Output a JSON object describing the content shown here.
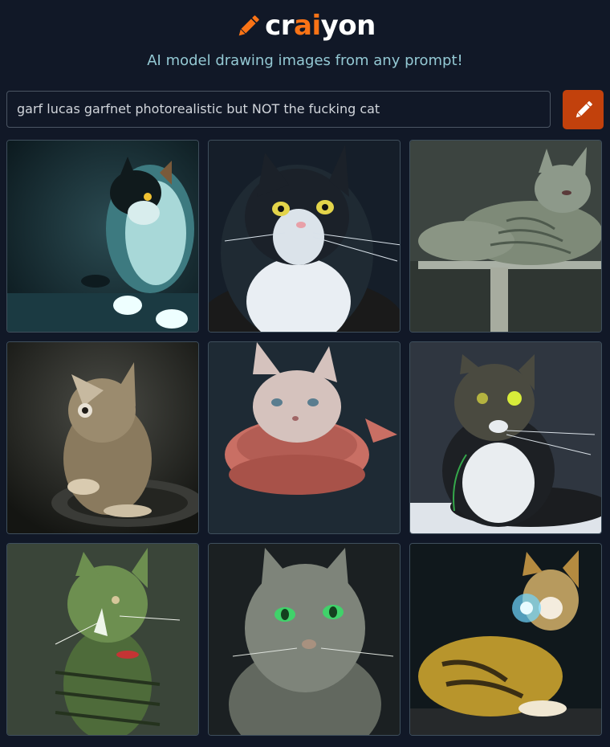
{
  "header": {
    "logo_text_pre": "cr",
    "logo_text_accent": "ai",
    "logo_text_post": "yon",
    "tagline": "AI model drawing images from any prompt!"
  },
  "prompt": {
    "value": "garf lucas garfnet photorealistic but NOT the fucking cat",
    "button_icon": "pencil-icon"
  },
  "colors": {
    "background": "#111827",
    "accent": "#f97316",
    "button": "#c2410c",
    "tagline": "#94c9d4"
  },
  "gallery": {
    "images": [
      {
        "description": "black and white cat, teal tint"
      },
      {
        "description": "black and white cat with yellow eyes"
      },
      {
        "description": "grey tabby lying on shelf"
      },
      {
        "description": "tabby cat sitting in bowl"
      },
      {
        "description": "pale cat on red cushion"
      },
      {
        "description": "black and white cat with glowing eye"
      },
      {
        "description": "green-tinted cat with collar"
      },
      {
        "description": "grey cat with green eyes"
      },
      {
        "description": "calico cat with light glow"
      }
    ]
  }
}
